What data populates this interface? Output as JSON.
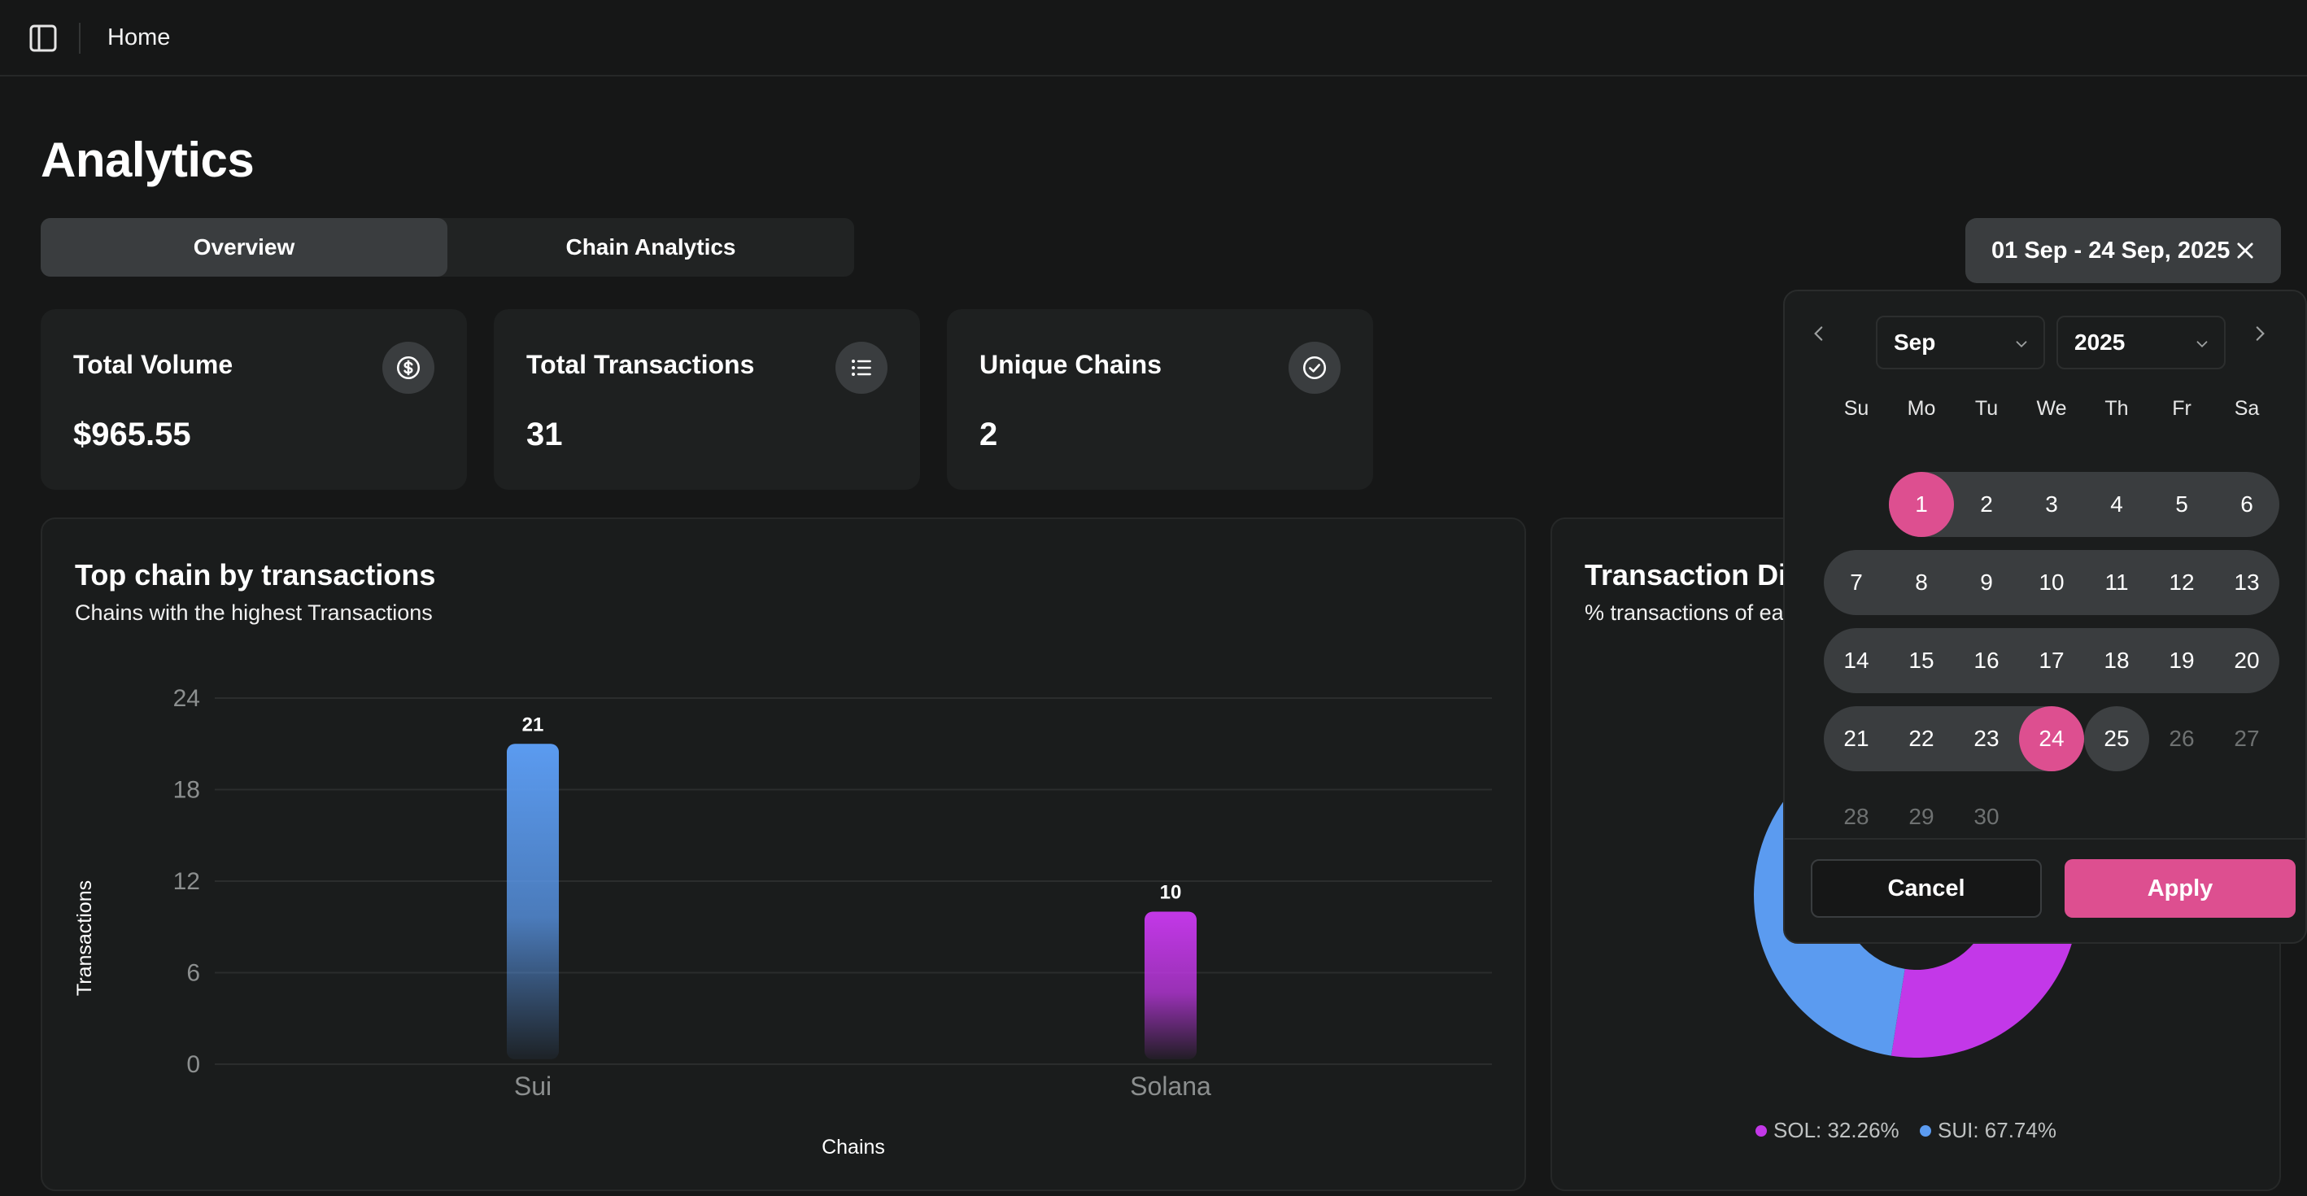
{
  "topbar": {
    "breadcrumb": "Home"
  },
  "page": {
    "title": "Analytics"
  },
  "tabs": [
    {
      "label": "Overview",
      "active": true
    },
    {
      "label": "Chain Analytics",
      "active": false
    }
  ],
  "date_range": {
    "label": "01 Sep - 24 Sep, 2025"
  },
  "stats": [
    {
      "label": "Total Volume",
      "value": "$965.55",
      "icon": "dollar-circle-icon"
    },
    {
      "label": "Total Transactions",
      "value": "31",
      "icon": "list-icon"
    },
    {
      "label": "Unique Chains",
      "value": "2",
      "icon": "check-circle-icon"
    }
  ],
  "bar_card": {
    "title": "Top chain by transactions",
    "subtitle": "Chains with the highest Transactions"
  },
  "pie_card": {
    "title": "Transaction Dis",
    "subtitle": "% transactions of ea"
  },
  "calendar": {
    "month": "Sep",
    "year": "2025",
    "weekdays": [
      "Su",
      "Mo",
      "Tu",
      "We",
      "Th",
      "Fr",
      "Sa"
    ],
    "range_start": 1,
    "range_end": 24,
    "today": 25,
    "cancel_label": "Cancel",
    "apply_label": "Apply"
  },
  "colors": {
    "accent": "#dd4f90",
    "sui": "#5b9bf0",
    "sol": "#c338e8"
  },
  "chart_data": [
    {
      "type": "bar",
      "title": "Top chain by transactions",
      "subtitle": "Chains with the highest Transactions",
      "categories": [
        "Sui",
        "Solana"
      ],
      "values": [
        21,
        10
      ],
      "data_labels": [
        "21",
        "10"
      ],
      "xlabel": "Chains",
      "ylabel": "Transactions",
      "ylim": [
        0,
        24
      ],
      "yticks": [
        "0",
        "6",
        "12",
        "18",
        "24"
      ],
      "grid": true
    },
    {
      "type": "pie",
      "title": "Transaction Dis",
      "subtitle": "% transactions of ea",
      "labels": [
        "SOL",
        "SUI"
      ],
      "values": [
        32.26,
        67.74
      ],
      "legend": [
        "SOL: 32.26%",
        "SUI: 67.74%"
      ],
      "legend_position": "bottom"
    }
  ]
}
